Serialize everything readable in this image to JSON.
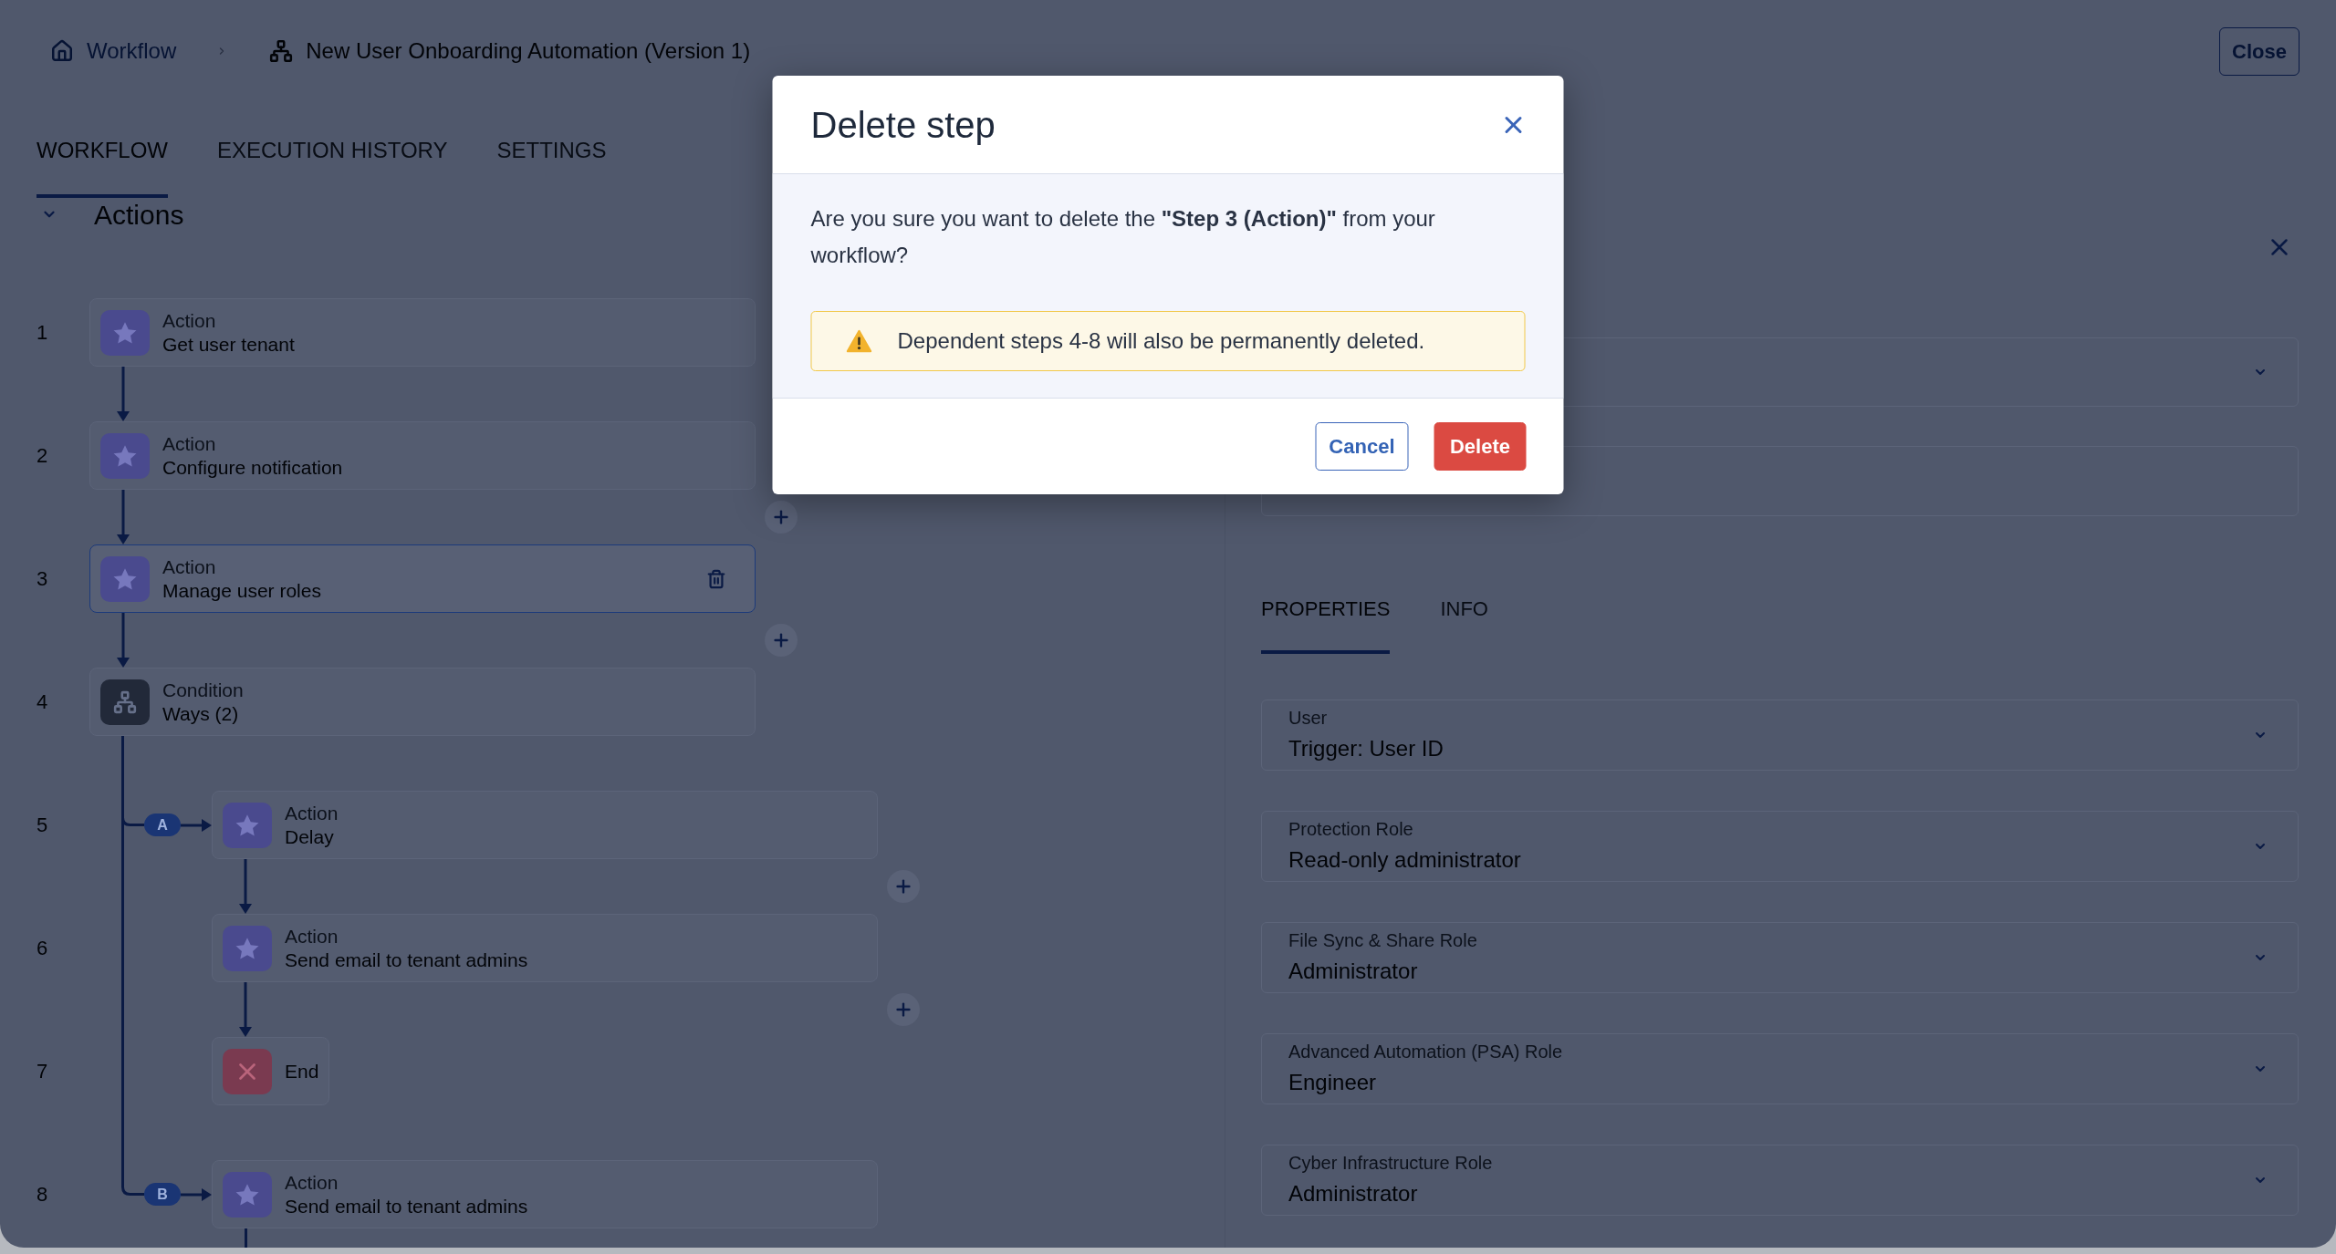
{
  "breadcrumb": [
    {
      "kind": "link",
      "label": "Workflow"
    },
    {
      "kind": "current",
      "label": "New User Onboarding Automation (Version 1)"
    }
  ],
  "close_button": "Close",
  "tabs": [
    {
      "label": "WORKFLOW",
      "selected": true
    },
    {
      "label": "EXECUTION HISTORY",
      "selected": false
    },
    {
      "label": "SETTINGS",
      "selected": false
    }
  ],
  "actions": {
    "title": "Actions",
    "expanded": true,
    "steps": [
      {
        "number": "1",
        "kind": "action",
        "type_label": "Action",
        "title": "Get user tenant",
        "selected": false,
        "add_after": false
      },
      {
        "number": "2",
        "kind": "action",
        "type_label": "Action",
        "title": "Configure notification",
        "selected": false,
        "add_after": true
      },
      {
        "number": "3",
        "kind": "action",
        "type_label": "Action",
        "title": "Manage user roles",
        "selected": true,
        "add_after": true
      },
      {
        "number": "4",
        "kind": "condition",
        "type_label": "Condition",
        "title": "Ways (2)",
        "selected": false,
        "branches": [
          {
            "label": "A",
            "children": [
              {
                "number": "5",
                "kind": "action",
                "type_label": "Action",
                "title": "Delay",
                "selected": false,
                "add_after": true
              },
              {
                "number": "6",
                "kind": "action",
                "type_label": "Action",
                "title": "Send email to tenant admins",
                "selected": false,
                "add_after": true
              },
              {
                "number": "7",
                "kind": "end",
                "title": "End",
                "selected": false
              }
            ]
          },
          {
            "label": "B",
            "children": [
              {
                "number": "8",
                "kind": "action",
                "type_label": "Action",
                "title": "Send email to tenant admins",
                "selected": false,
                "continues": true
              }
            ]
          }
        ]
      }
    ]
  },
  "properties_panel": {
    "tabs": [
      {
        "label": "PROPERTIES",
        "selected": true
      },
      {
        "label": "INFO",
        "selected": false
      }
    ],
    "fields": [
      {
        "label": "User",
        "value": "Trigger: User ID"
      },
      {
        "label": "Protection Role",
        "value": "Read-only administrator"
      },
      {
        "label": "File Sync & Share Role",
        "value": "Administrator"
      },
      {
        "label": "Advanced Automation (PSA) Role",
        "value": "Engineer"
      },
      {
        "label": "Cyber Infrastructure Role",
        "value": "Administrator"
      }
    ]
  },
  "dialog": {
    "title": "Delete step",
    "message": "Are you sure you want to delete the **\"Step 3 (Action)\"** from your workflow?",
    "warning": "Dependent steps 4-8 will also be permanently deleted.",
    "buttons": [
      {
        "label": "Cancel",
        "kind": "secondary"
      },
      {
        "label": "Delete",
        "kind": "danger"
      }
    ]
  }
}
